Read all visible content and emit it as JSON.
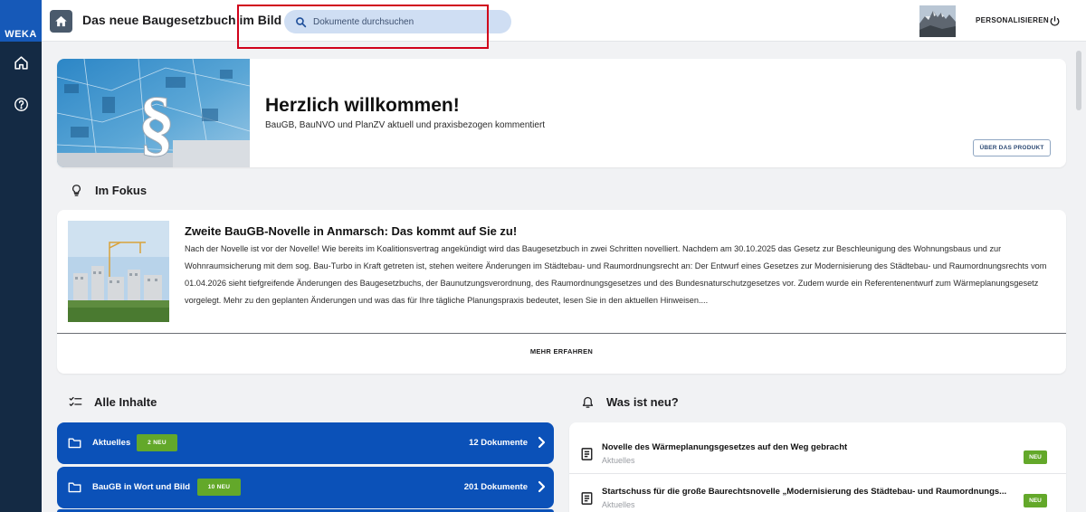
{
  "brand": {
    "logo_text": "WEKA"
  },
  "header": {
    "title": "Das neue Baugesetzbuch im Bild",
    "search_placeholder": "Dokumente durchsuchen",
    "personalize_label": "PERSONALISIEREN"
  },
  "welcome": {
    "title": "Herzlich willkommen!",
    "subtitle": "BauGB, BauNVO und PlanZV aktuell und praxisbezogen kommentiert",
    "product_button": "ÜBER DAS PRODUKT"
  },
  "focus": {
    "heading": "Im Fokus",
    "article_title": "Zweite BauGB-Novelle in Anmarsch: Das kommt auf Sie zu!",
    "article_text": "Nach der Novelle ist vor der Novelle! Wie bereits im Koalitionsvertrag angekündigt wird das Baugesetzbuch in zwei Schritten novelliert. Nachdem am 30.10.2025 das Gesetz zur Beschleunigung des Wohnungsbaus und zur Wohnraumsicherung mit dem sog. Bau-Turbo in Kraft getreten ist, stehen weitere Änderungen im Städtebau- und Raumordnungsrecht an: Der Entwurf eines Gesetzes zur Modernisierung des Städtebau- und Raumordnungsrechts vom 01.04.2026 sieht tiefgreifende Änderungen des Baugesetzbuchs, der Baunutzungsverordnung, des Raumordnungsgesetzes und des Bundesnaturschutzgesetzes vor. Zudem wurde ein Referentenentwurf zum Wärmeplanungsgesetz vorgelegt. Mehr zu den geplanten Änderungen und was das für Ihre tägliche Planungspraxis bedeutet, lesen Sie in den aktuellen Hinweisen....",
    "more_label": "MEHR ERFAHREN"
  },
  "contents": {
    "heading": "Alle Inhalte",
    "rows": [
      {
        "label": "Aktuelles",
        "badge": "2 NEU",
        "count": "12 Dokumente"
      },
      {
        "label": "BauGB in Wort und Bild",
        "badge": "10 NEU",
        "count": "201 Dokumente"
      }
    ]
  },
  "news": {
    "heading": "Was ist neu?",
    "items": [
      {
        "title": "Novelle des Wärmeplanungsgesetzes auf den Weg gebracht",
        "category": "Aktuelles",
        "badge": "NEU"
      },
      {
        "title": "Startschuss für die große Baurechtsnovelle „Modernisierung des Städtebau- und Raumordnungs...",
        "category": "Aktuelles",
        "badge": "NEU"
      }
    ]
  },
  "colors": {
    "rail": "#142a44",
    "logo_bg": "#1659b8",
    "primary_blue": "#0b51b8",
    "badge_green": "#63a82a",
    "search_bg": "#cfdef3",
    "highlight_red": "#d0021b"
  }
}
